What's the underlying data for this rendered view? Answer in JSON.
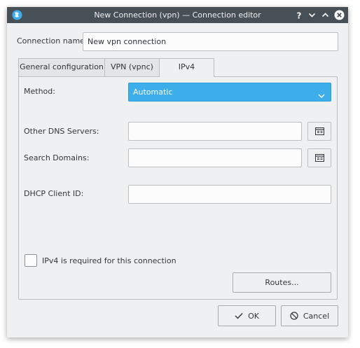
{
  "window": {
    "title": "New Connection (vpn) — Connection editor",
    "buttons": [
      "help-icon",
      "minimize-icon",
      "maximize-icon",
      "close-icon"
    ]
  },
  "connection_name": {
    "label": "Connection name:",
    "value": "New vpn connection"
  },
  "tabs": [
    {
      "label": "General configuration"
    },
    {
      "label": "VPN (vpnc)"
    },
    {
      "label": "IPv4",
      "active": true
    }
  ],
  "ipv4": {
    "method_label": "Method:",
    "method_value": "Automatic",
    "dns_label": "Other DNS Servers:",
    "dns_value": "",
    "search_label": "Search Domains:",
    "search_value": "",
    "dhcp_label": "DHCP Client ID:",
    "dhcp_value": "",
    "required_label": "IPv4 is required for this connection",
    "required_checked": false,
    "routes_label": "Routes..."
  },
  "footer": {
    "ok_label": "OK",
    "cancel_label": "Cancel"
  },
  "colors": {
    "titlebar": "#475057",
    "accent": "#3daee9",
    "window_bg": "#eff0f1"
  }
}
